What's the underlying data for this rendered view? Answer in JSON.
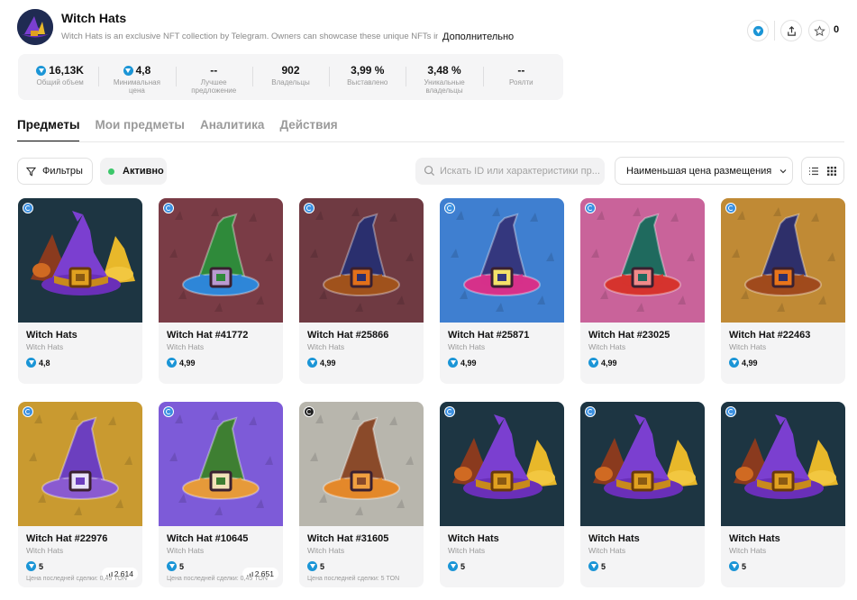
{
  "collection": {
    "title": "Witch Hats",
    "description": "Witch Hats is an exclusive NFT collection by Telegram. Owners can showcase these unique NFTs in the",
    "more_label": "Дополнительно",
    "favorites_count": "0"
  },
  "header_icons": [
    "ton-icon",
    "share-icon",
    "star-icon"
  ],
  "stats": [
    {
      "value": "16,13K",
      "label": "Общий объем",
      "ton": true
    },
    {
      "value": "4,8",
      "label": "Минимальная цена",
      "ton": true
    },
    {
      "value": "--",
      "label": "Лучшее предложение",
      "ton": false
    },
    {
      "value": "902",
      "label": "Владельцы",
      "ton": false
    },
    {
      "value": "3,99 %",
      "label": "Выставлено",
      "ton": false
    },
    {
      "value": "3,48 %",
      "label": "Уникальные владельцы",
      "ton": false
    },
    {
      "value": "--",
      "label": "Роялти",
      "ton": false
    }
  ],
  "tabs": [
    {
      "label": "Предметы",
      "active": true
    },
    {
      "label": "Мои предметы",
      "active": false
    },
    {
      "label": "Аналитика",
      "active": false
    },
    {
      "label": "Действия",
      "active": false
    }
  ],
  "toolbar": {
    "filters_label": "Фильтры",
    "status_label": "Активно",
    "search_placeholder": "Искать ID или характеристики пр...",
    "sort_label": "Наименьшая цена размещения"
  },
  "colors": {
    "ton": "#1b95d6",
    "active_dot": "#3cc76a"
  },
  "items": [
    {
      "name": "Witch Hats",
      "collection": "Witch Hats",
      "price": "4,8",
      "rank": null,
      "last_sale": null,
      "badge": "blue",
      "bg": "#1d3542",
      "hat": "#7b3fd0",
      "band": "#c88a1c",
      "buckle": "#e0a020",
      "multi": true
    },
    {
      "name": "Witch Hat #41772",
      "collection": "Witch Hats",
      "price": "4,99",
      "rank": null,
      "last_sale": null,
      "badge": "blue",
      "bg": "#7a3c46",
      "hat": "#2f8a3a",
      "band": "#2e86d8",
      "buckle": "#b99ad0",
      "multi": false
    },
    {
      "name": "Witch Hat #25866",
      "collection": "Witch Hats",
      "price": "4,99",
      "rank": null,
      "last_sale": null,
      "badge": "blue",
      "bg": "#6f3a42",
      "hat": "#2a2f6e",
      "band": "#a0521c",
      "buckle": "#e2701a",
      "multi": false
    },
    {
      "name": "Witch Hat #25871",
      "collection": "Witch Hats",
      "price": "4,99",
      "rank": null,
      "last_sale": null,
      "badge": "blue",
      "bg": "#3f7fd0",
      "hat": "#34377e",
      "band": "#d6318a",
      "buckle": "#f4e26a",
      "multi": false
    },
    {
      "name": "Witch Hat #23025",
      "collection": "Witch Hats",
      "price": "4,99",
      "rank": null,
      "last_sale": null,
      "badge": "blue",
      "bg": "#c9639a",
      "hat": "#1f6a5e",
      "band": "#d6332e",
      "buckle": "#f08a8a",
      "multi": false
    },
    {
      "name": "Witch Hat #22463",
      "collection": "Witch Hats",
      "price": "4,99",
      "rank": null,
      "last_sale": null,
      "badge": "blue",
      "bg": "#c08a35",
      "hat": "#2e2f6a",
      "band": "#a04a1c",
      "buckle": "#e8741a",
      "multi": false
    },
    {
      "name": "Witch Hat #22976",
      "collection": "Witch Hats",
      "price": "5",
      "rank": "2 614",
      "last_sale": "Цена последней сделки: 0,45 TON",
      "badge": "blue",
      "bg": "#c99a30",
      "hat": "#6c3fbf",
      "band": "#8a5ad0",
      "buckle": "#e8e2f8",
      "multi": false
    },
    {
      "name": "Witch Hat #10645",
      "collection": "Witch Hats",
      "price": "5",
      "rank": "2 651",
      "last_sale": "Цена последней сделки: 0,45 TON",
      "badge": "blue",
      "bg": "#7d5bd8",
      "hat": "#3e7f32",
      "band": "#e69a3a",
      "buckle": "#f2e2b8",
      "multi": false
    },
    {
      "name": "Witch Hat #31605",
      "collection": "Witch Hats",
      "price": "5",
      "rank": null,
      "last_sale": "Цена последней сделки: 5 TON",
      "badge": "dark",
      "bg": "#b8b6ad",
      "hat": "#8a4a2a",
      "band": "#e3882a",
      "buckle": "#f0a040",
      "multi": false
    },
    {
      "name": "Witch Hats",
      "collection": "Witch Hats",
      "price": "5",
      "rank": null,
      "last_sale": null,
      "badge": "blue",
      "bg": "#1d3542",
      "hat": "#7b3fd0",
      "band": "#c88a1c",
      "buckle": "#e0a020",
      "multi": true
    },
    {
      "name": "Witch Hats",
      "collection": "Witch Hats",
      "price": "5",
      "rank": null,
      "last_sale": null,
      "badge": "blue",
      "bg": "#1d3542",
      "hat": "#7b3fd0",
      "band": "#c88a1c",
      "buckle": "#e0a020",
      "multi": true
    },
    {
      "name": "Witch Hats",
      "collection": "Witch Hats",
      "price": "5",
      "rank": null,
      "last_sale": null,
      "badge": "blue",
      "bg": "#1d3542",
      "hat": "#7b3fd0",
      "band": "#c88a1c",
      "buckle": "#e0a020",
      "multi": true
    }
  ]
}
